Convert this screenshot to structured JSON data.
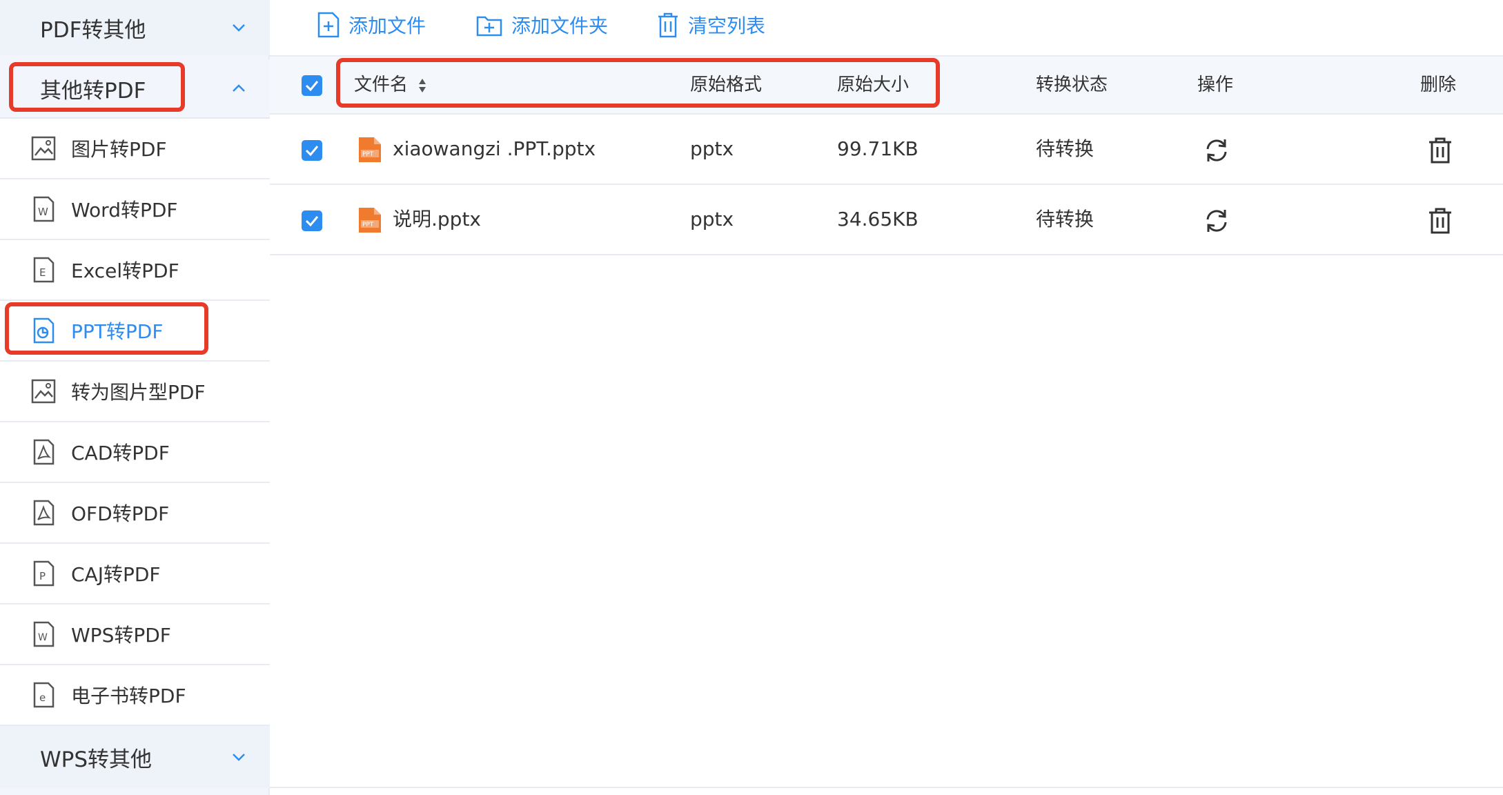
{
  "sidebar": {
    "groups": [
      {
        "label": "PDF转其他",
        "expanded": false
      },
      {
        "label": "其他转PDF",
        "expanded": true
      },
      {
        "label": "WPS转其他",
        "expanded": false
      }
    ],
    "items": [
      {
        "label": "图片转PDF",
        "icon": "image-file-icon"
      },
      {
        "label": "Word转PDF",
        "icon": "word-file-icon"
      },
      {
        "label": "Excel转PDF",
        "icon": "excel-file-icon"
      },
      {
        "label": "PPT转PDF",
        "icon": "ppt-file-icon",
        "active": true
      },
      {
        "label": "转为图片型PDF",
        "icon": "image-file-icon"
      },
      {
        "label": "CAD转PDF",
        "icon": "pdf-file-icon"
      },
      {
        "label": "OFD转PDF",
        "icon": "pdf-file-icon"
      },
      {
        "label": "CAJ转PDF",
        "icon": "caj-file-icon"
      },
      {
        "label": "WPS转PDF",
        "icon": "wps-file-icon"
      },
      {
        "label": "电子书转PDF",
        "icon": "ebook-file-icon"
      }
    ]
  },
  "toolbar": {
    "add_file": "添加文件",
    "add_folder": "添加文件夹",
    "clear_list": "清空列表"
  },
  "table": {
    "headers": {
      "filename": "文件名",
      "format": "原始格式",
      "size": "原始大小",
      "status": "转换状态",
      "action": "操作",
      "delete": "删除"
    },
    "rows": [
      {
        "name": "xiaowangzi .PPT.pptx",
        "format": "pptx",
        "size": "99.71KB",
        "status": "待转换",
        "checked": true
      },
      {
        "name": "说明.pptx",
        "format": "pptx",
        "size": "34.65KB",
        "status": "待转换",
        "checked": true
      }
    ]
  },
  "colors": {
    "accent": "#2d8cf0",
    "highlight": "#e63b28",
    "ppt_icon": "#f07a2e"
  }
}
